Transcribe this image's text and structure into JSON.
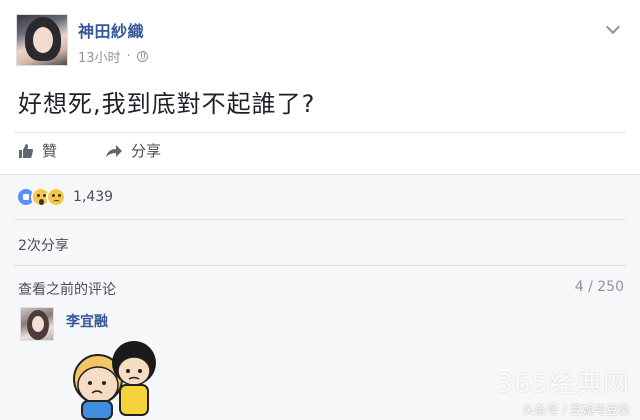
{
  "post": {
    "author": "神田紗織",
    "time": "13小时",
    "content": "好想死,我到底對不起誰了?"
  },
  "actions": {
    "like_label": "贊",
    "share_label": "分享"
  },
  "feedback": {
    "reaction_count": "1,439",
    "share_count": "2次分享",
    "view_previous": "查看之前的评论",
    "pager": "4 / 250"
  },
  "comment": {
    "author": "李宜融"
  },
  "overlay": {
    "watermark": "365经典网",
    "source": "头条号 / 豆娛与豆樂"
  },
  "colors": {
    "link_blue": "#365899",
    "like_blue": "#5890ff",
    "reaction_yellow": "#f7c948",
    "muted_gray": "#90949c"
  }
}
